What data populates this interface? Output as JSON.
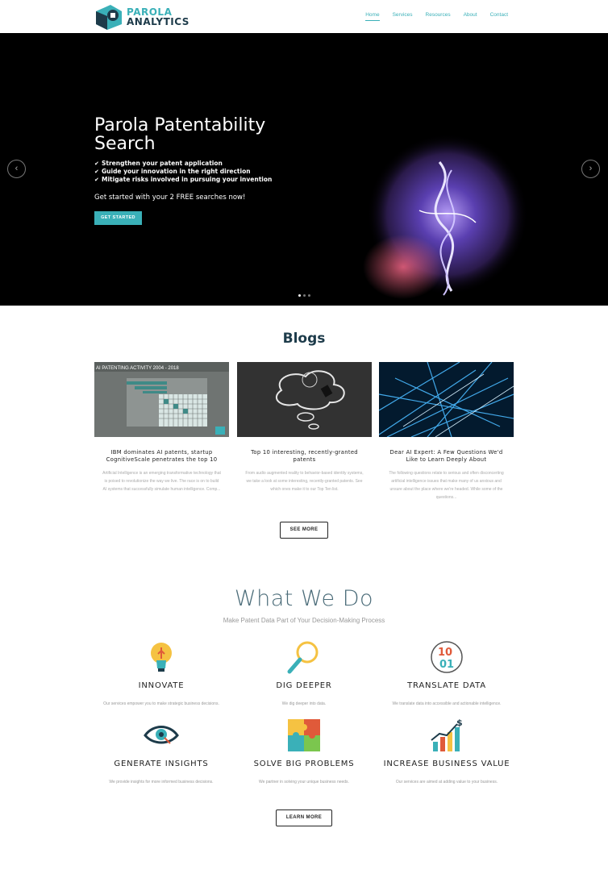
{
  "header": {
    "logo": {
      "line1": "PAROLA",
      "line2": "ANALYTICS"
    },
    "nav": [
      {
        "label": "Home",
        "active": true
      },
      {
        "label": "Services",
        "active": false
      },
      {
        "label": "Resources",
        "active": false
      },
      {
        "label": "About",
        "active": false
      },
      {
        "label": "Contact",
        "active": false
      }
    ]
  },
  "hero": {
    "title": "Parola Patentability Search",
    "bullets": [
      "Strengthen your patent application",
      "Guide your innovation in the right direction",
      "Mitigate risks involved in pursuing your invention"
    ],
    "cta_text": "Get started with your 2 FREE searches now!",
    "button_label": "GET STARTED",
    "prev_icon": "chevron-left-icon",
    "next_icon": "chevron-right-icon",
    "slides": 3,
    "active_slide": 1
  },
  "blogs": {
    "title": "Blogs",
    "posts": [
      {
        "title": "IBM dominates AI patents, startup CognitiveScale penetrates the top 10",
        "excerpt": "Artificial Intelligence is an emerging transformative technology that is poised to revolutionize the way we live. The race is on to build AI systems that successfully simulate human intelligence. Comp...",
        "image_caption": "AI PATENTING ACTIVITY 2004 - 2018"
      },
      {
        "title": "Top 10 interesting, recently-granted patents",
        "excerpt": "From audio augmented reality to behavior-based identity systems, we take a look at some interesting, recently-granted patents. See which ones make it to our Top Ten list."
      },
      {
        "title": "Dear AI Expert: A Few Questions We'd Like to Learn Deeply About",
        "excerpt": "The following questions relate to serious and often disconcerting artificial intelligence issues that make many of us anxious and unsure about the place where we're headed. While some of the questions..."
      }
    ],
    "see_more_label": "SEE MORE"
  },
  "what_we_do": {
    "title": "What We Do",
    "subtitle": "Make Patent Data Part of Your Decision-Making Process",
    "features": [
      {
        "title": "INNOVATE",
        "text": "Our services empower you to make strategic business decisions.",
        "icon": "lightbulb-icon"
      },
      {
        "title": "DIG DEEPER",
        "text": "We dig deeper into data.",
        "icon": "magnifier-icon"
      },
      {
        "title": "TRANSLATE DATA",
        "text": "We translate data into accessible and actionable intelligence.",
        "icon": "binary-icon"
      },
      {
        "title": "GENERATE INSIGHTS",
        "text": "We provide insights for more informed business decisions.",
        "icon": "eye-icon"
      },
      {
        "title": "SOLVE BIG PROBLEMS",
        "text": "We partner in solving your unique business needs.",
        "icon": "puzzle-icon"
      },
      {
        "title": "INCREASE BUSINESS VALUE",
        "text": "Our services are aimed at adding value to your business.",
        "icon": "growth-chart-icon"
      }
    ],
    "learn_more_label": "LEARN MORE"
  },
  "colors": {
    "accent": "#3ab0b8",
    "navy": "#1d3b4a"
  }
}
